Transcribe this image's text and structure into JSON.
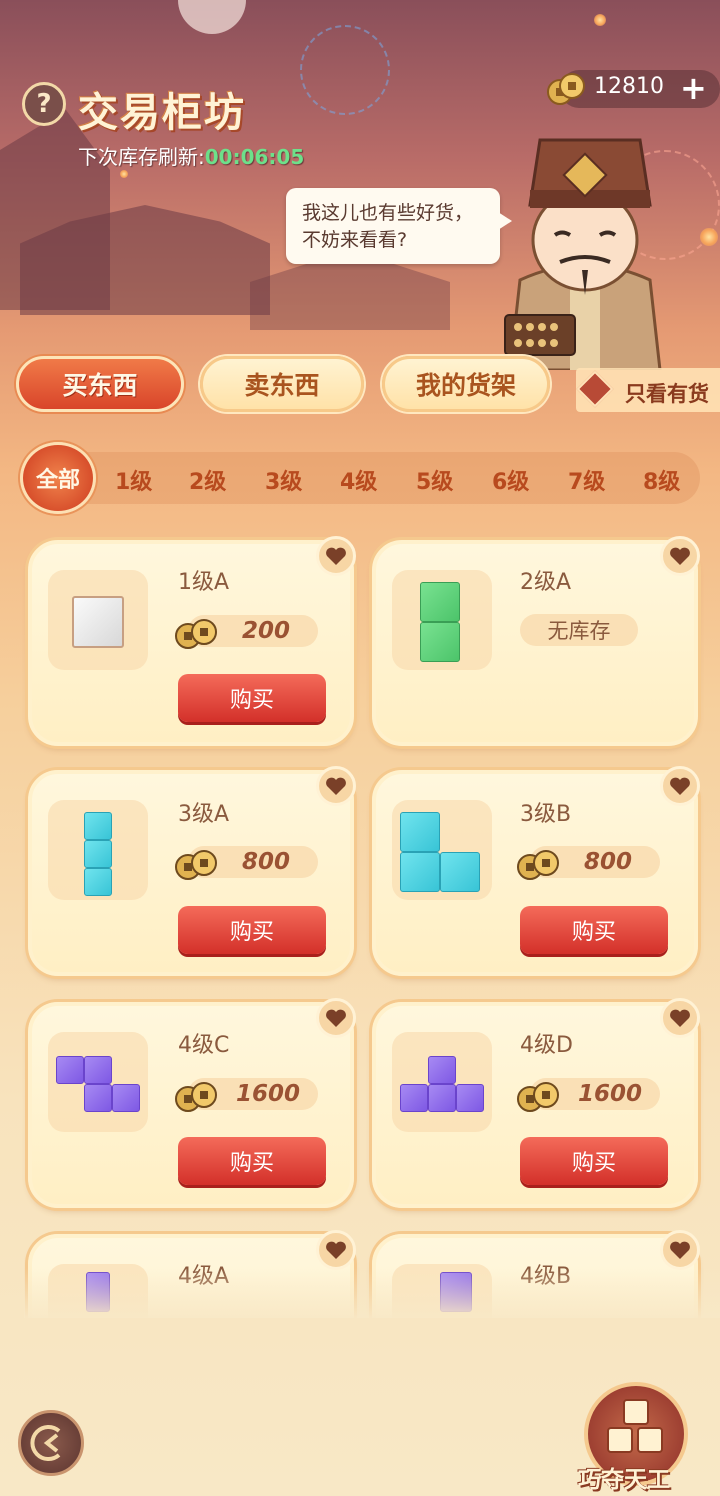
{
  "header": {
    "title": "交易柜坊",
    "refresh_label": "下次库存刷新:",
    "refresh_timer": "00:06:05",
    "coins": "12810",
    "plus": "+",
    "help": "?",
    "merchant_speech": "我这儿也有些好货，不妨来看看?"
  },
  "tabs": {
    "buy": "买东西",
    "sell": "卖东西",
    "shelf": "我的货架",
    "in_stock_only": "只看有货"
  },
  "levels": [
    "全部",
    "1级",
    "2级",
    "3级",
    "4级",
    "5级",
    "6级",
    "7级",
    "8级"
  ],
  "items": [
    {
      "name": "1级A",
      "price": "200",
      "button": "购买",
      "color": "gray"
    },
    {
      "name": "2级A",
      "status": "无库存",
      "color": "green"
    },
    {
      "name": "3级A",
      "price": "800",
      "button": "购买",
      "color": "cyan"
    },
    {
      "name": "3级B",
      "price": "800",
      "button": "购买",
      "color": "cyan"
    },
    {
      "name": "4级C",
      "price": "1600",
      "button": "购买",
      "color": "purple"
    },
    {
      "name": "4级D",
      "price": "1600",
      "button": "购买",
      "color": "purple"
    },
    {
      "name": "4级A",
      "color": "purple"
    },
    {
      "name": "4级B",
      "color": "purple"
    }
  ],
  "footer": {
    "game_label": "巧夺天工"
  },
  "colors": {
    "accent_red": "#d3302a",
    "timer_green": "#6de08a",
    "tab_active": "#e05a34"
  }
}
